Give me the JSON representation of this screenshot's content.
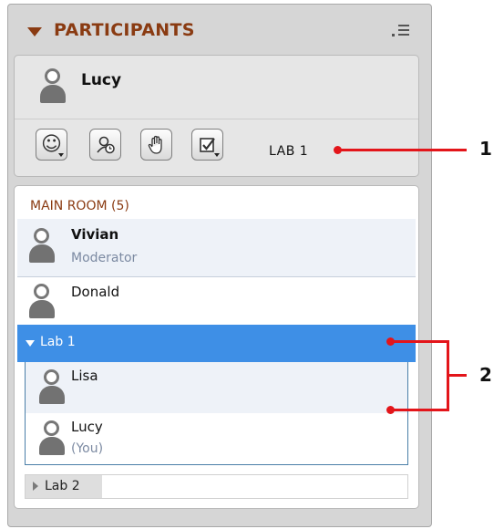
{
  "panel": {
    "title": "PARTICIPANTS"
  },
  "me": {
    "name": "Lucy",
    "room_label": "LAB 1"
  },
  "toolbar": {
    "buttons": [
      "status-emoticon",
      "away-timer",
      "raise-hand",
      "agree-checkbox"
    ]
  },
  "main_room": {
    "label": "MAIN ROOM",
    "count": "(5)",
    "participants": [
      {
        "name": "Vivian",
        "role": "Moderator"
      },
      {
        "name": "Donald",
        "role": ""
      }
    ]
  },
  "breakout_rooms": [
    {
      "label": "Lab 1",
      "expanded": true,
      "participants": [
        {
          "name": "Lisa",
          "note": ""
        },
        {
          "name": "Lucy",
          "note": "(You)"
        }
      ]
    },
    {
      "label": "Lab 2",
      "expanded": false
    }
  ],
  "callouts": {
    "one": "1",
    "two": "2"
  },
  "colors": {
    "accent_brown": "#8a3b12",
    "selected_blue": "#3e8fe6",
    "callout_red": "#e3151a"
  }
}
